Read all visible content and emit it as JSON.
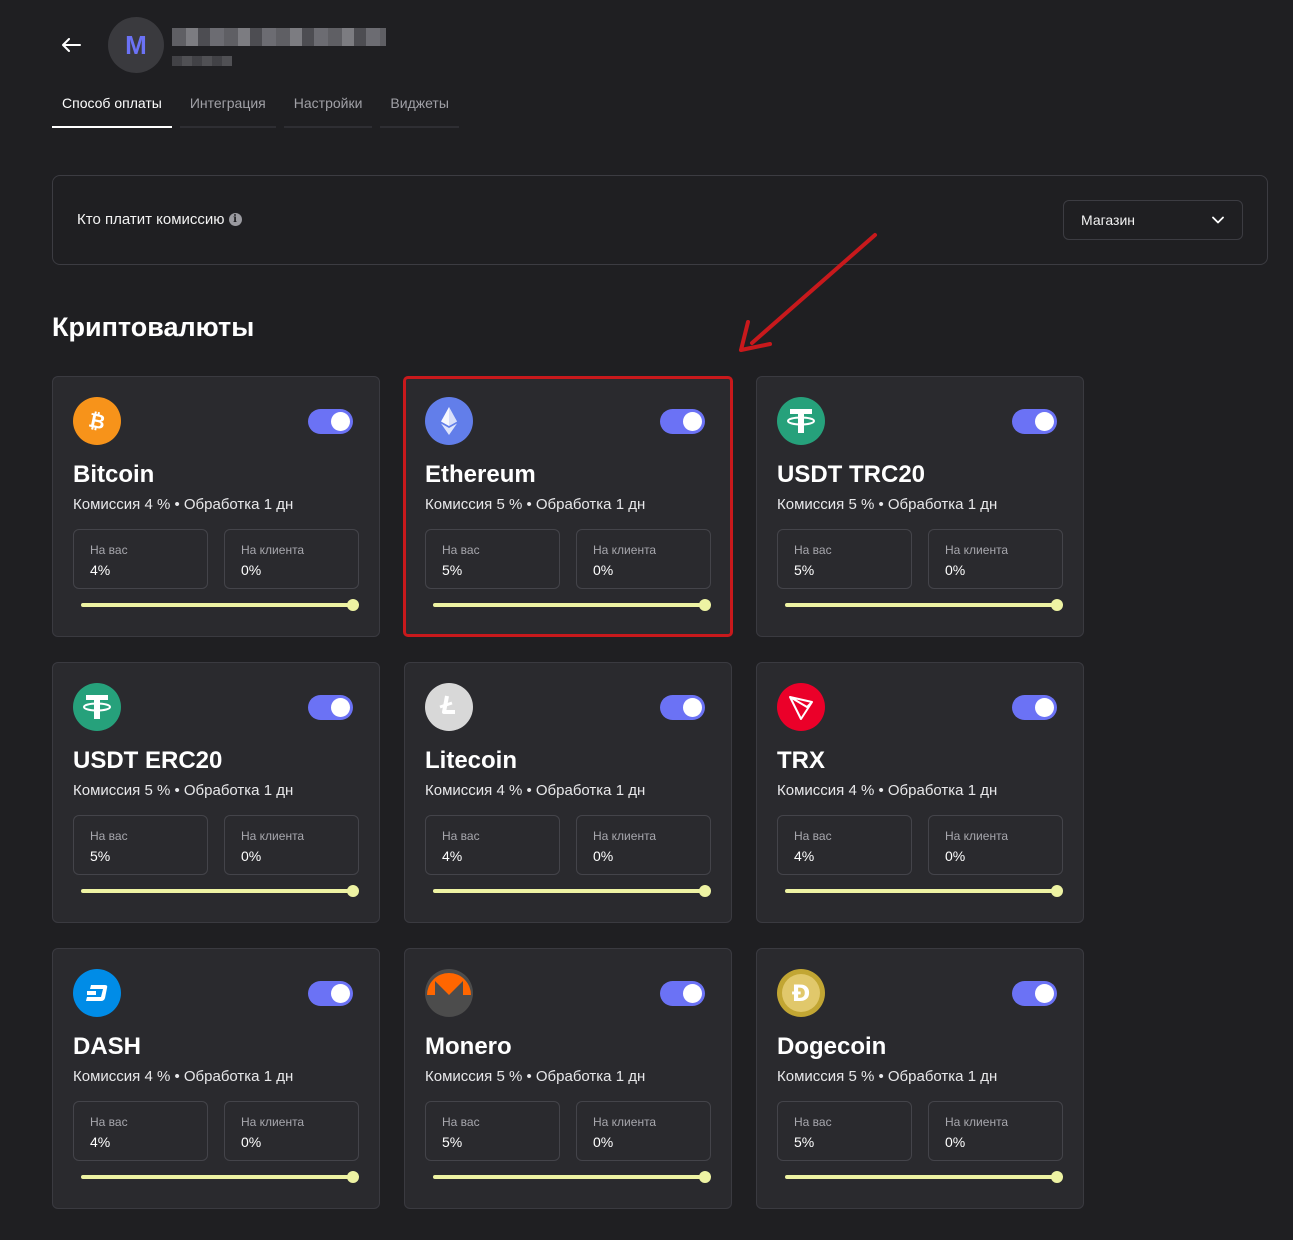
{
  "header": {
    "avatar_letter": "M",
    "accent": "#6b72f5"
  },
  "tabs": [
    {
      "label": "Способ оплаты",
      "active": true
    },
    {
      "label": "Интеграция",
      "active": false
    },
    {
      "label": "Настройки",
      "active": false
    },
    {
      "label": "Виджеты",
      "active": false
    }
  ],
  "fee": {
    "label": "Кто платит комиссию",
    "selected": "Магазин"
  },
  "section_title": "Криптовалюты",
  "labels": {
    "on_you": "На вас",
    "on_client": "На клиента",
    "commission_prefix": "Комиссия",
    "processing": "Обработка 1 дн"
  },
  "coins": [
    {
      "name": "Bitcoin",
      "meta": "Комиссия 4 % • Обработка 1 дн",
      "you": "4%",
      "client": "0%",
      "icon": "bitcoin-icon",
      "color": "#f7931a",
      "enabled": true,
      "you_share": 1.0
    },
    {
      "name": "Ethereum",
      "meta": "Комиссия 5 % • Обработка 1 дн",
      "you": "5%",
      "client": "0%",
      "icon": "ethereum-icon",
      "color": "#627eea",
      "enabled": true,
      "you_share": 1.0
    },
    {
      "name": "USDT TRC20",
      "meta": "Комиссия 5 % • Обработка 1 дн",
      "you": "5%",
      "client": "0%",
      "icon": "tether-icon",
      "color": "#26a17b",
      "enabled": true,
      "you_share": 1.0
    },
    {
      "name": "USDT ERC20",
      "meta": "Комиссия 5 % • Обработка 1 дн",
      "you": "5%",
      "client": "0%",
      "icon": "tether-icon",
      "color": "#26a17b",
      "enabled": true,
      "you_share": 1.0
    },
    {
      "name": "Litecoin",
      "meta": "Комиссия 4 % • Обработка 1 дн",
      "you": "4%",
      "client": "0%",
      "icon": "litecoin-icon",
      "color": "#d8d8d8",
      "enabled": true,
      "you_share": 1.0
    },
    {
      "name": "TRX",
      "meta": "Комиссия 4 % • Обработка 1 дн",
      "you": "4%",
      "client": "0%",
      "icon": "tron-icon",
      "color": "#eb0029",
      "enabled": true,
      "you_share": 1.0
    },
    {
      "name": "DASH",
      "meta": "Комиссия 4 % • Обработка 1 дн",
      "you": "4%",
      "client": "0%",
      "icon": "dash-icon",
      "color": "#008ce7",
      "enabled": true,
      "you_share": 1.0
    },
    {
      "name": "Monero",
      "meta": "Комиссия 5 % • Обработка 1 дн",
      "you": "5%",
      "client": "0%",
      "icon": "monero-icon",
      "color": "#ff6600",
      "enabled": true,
      "you_share": 1.0
    },
    {
      "name": "Dogecoin",
      "meta": "Комиссия 5 % • Обработка 1 дн",
      "you": "5%",
      "client": "0%",
      "icon": "dogecoin-icon",
      "color": "#c2a633",
      "enabled": true,
      "you_share": 1.0
    }
  ],
  "annotation": {
    "highlighted_card": "Ethereum",
    "color": "#c8191c"
  }
}
